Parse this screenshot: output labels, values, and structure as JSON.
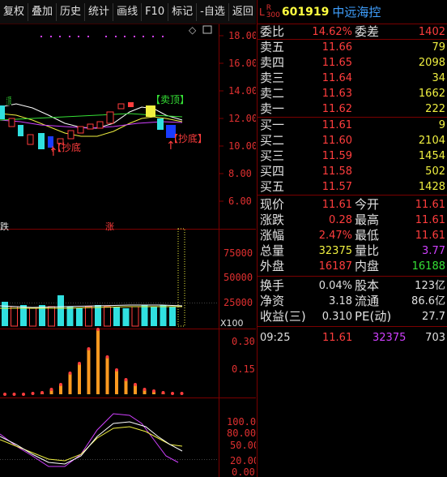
{
  "toolbar": {
    "items": [
      "复权",
      "叠加",
      "历史",
      "统计",
      "画线",
      "F10",
      "标记",
      "-自选",
      "返回"
    ]
  },
  "chart": {
    "price_ticks": [
      "18.00",
      "16.00",
      "14.00",
      "12.00",
      "10.00",
      "8.00",
      "6.00"
    ],
    "volume_ticks": [
      "75000",
      "50000",
      "25000"
    ],
    "volume_unit": "X100",
    "ind1_ticks": [
      "0.30",
      "0.15"
    ],
    "ind2_ticks": [
      "100.00",
      "80.00",
      "50.00",
      "20.00",
      "0.00"
    ],
    "labels": {
      "sell_top": "【卖顶",
      "sell_top2": "【卖顶】",
      "buy_bottom1": "【抄底",
      "buy_bottom2": "【抄底】",
      "left_tag": "跌",
      "mid_tag": "涨"
    },
    "colors": {
      "up": "#ff3d3d",
      "down": "#30e0e0",
      "ma_short": "#ffffff",
      "ma_mid": "#f0f040",
      "ma_long": "#d040ff",
      "ma_green": "#35e035"
    }
  },
  "quote": {
    "tag_l": "L",
    "tag_r_top": "R",
    "tag_r_bottom": "300",
    "code": "601919",
    "name": "中远海控",
    "weibi_label": "委比",
    "weibi_value": "14.62%",
    "weicha_label": "委差",
    "weicha_value": "1402",
    "sells": [
      {
        "label": "卖五",
        "price": "11.66",
        "vol": "79"
      },
      {
        "label": "卖四",
        "price": "11.65",
        "vol": "2098"
      },
      {
        "label": "卖三",
        "price": "11.64",
        "vol": "34"
      },
      {
        "label": "卖二",
        "price": "11.63",
        "vol": "1662"
      },
      {
        "label": "卖一",
        "price": "11.62",
        "vol": "222"
      }
    ],
    "buys": [
      {
        "label": "买一",
        "price": "11.61",
        "vol": "9"
      },
      {
        "label": "买二",
        "price": "11.60",
        "vol": "2104"
      },
      {
        "label": "买三",
        "price": "11.59",
        "vol": "1454"
      },
      {
        "label": "买四",
        "price": "11.58",
        "vol": "502"
      },
      {
        "label": "买五",
        "price": "11.57",
        "vol": "1428"
      }
    ],
    "stats": [
      {
        "l1": "现价",
        "v1": "11.61",
        "c1": "red",
        "l2": "今开",
        "v2": "11.61",
        "c2": "red"
      },
      {
        "l1": "涨跌",
        "v1": "0.28",
        "c1": "red",
        "l2": "最高",
        "v2": "11.61",
        "c2": "red"
      },
      {
        "l1": "涨幅",
        "v1": "2.47%",
        "c1": "red",
        "l2": "最低",
        "v2": "11.61",
        "c2": "red"
      },
      {
        "l1": "总量",
        "v1": "32375",
        "c1": "yellow",
        "l2": "量比",
        "v2": "3.77",
        "c2": "magenta"
      },
      {
        "l1": "外盘",
        "v1": "16187",
        "c1": "red",
        "l2": "内盘",
        "v2": "16188",
        "c2": "green"
      }
    ],
    "fund": [
      {
        "l1": "换手",
        "v1": "0.04%",
        "l2": "股本",
        "v2": "123亿"
      },
      {
        "l1": "净资",
        "v1": "3.18",
        "l2": "流通",
        "v2": "86.6亿"
      },
      {
        "l1": "收益(三)",
        "v1": "0.310",
        "l2": "PE(动)",
        "v2": "27.7"
      }
    ],
    "tick": {
      "time": "09:25",
      "price": "11.61",
      "vol": "32375",
      "extra": "703"
    }
  }
}
